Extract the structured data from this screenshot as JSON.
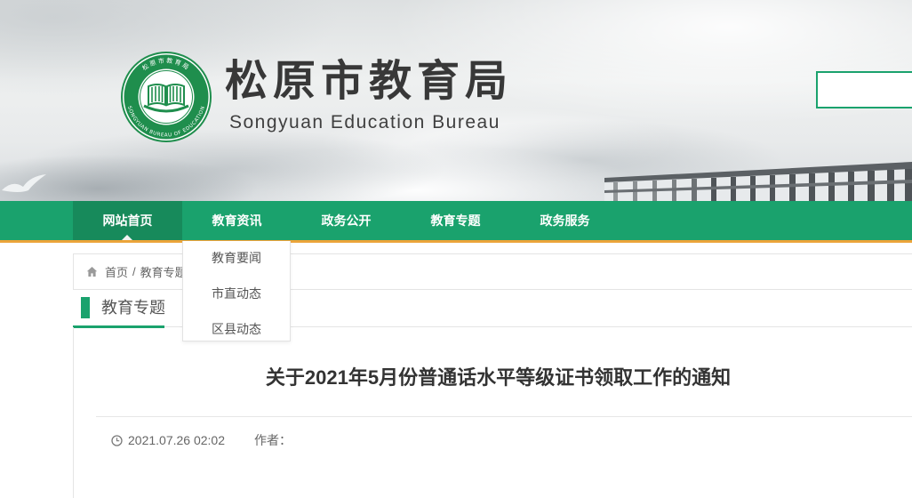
{
  "header": {
    "logo": {
      "icon": "book-emblem-icon",
      "ring_text_top": "松原市教育局",
      "ring_text_bottom": "SONGYUAN BUREAU OF EDUCATION"
    },
    "title": "松原市教育局",
    "subtitle": "Songyuan Education Bureau",
    "search": {
      "value": ""
    }
  },
  "nav": {
    "items": [
      {
        "label": "网站首页",
        "active": true
      },
      {
        "label": "教育资讯",
        "active": false
      },
      {
        "label": "政务公开",
        "active": false
      },
      {
        "label": "教育专题",
        "active": false
      },
      {
        "label": "政务服务",
        "active": false
      }
    ],
    "dropdown_items": [
      {
        "label": "教育要闻"
      },
      {
        "label": "市直动态"
      },
      {
        "label": "区县动态"
      }
    ]
  },
  "breadcrumb": {
    "icon": "home-icon",
    "home": "首页",
    "separator": "/",
    "current": "教育专题"
  },
  "section": {
    "title": "教育专题"
  },
  "article": {
    "title": "关于2021年5月份普通话水平等级证书领取工作的通知",
    "date_icon": "clock-icon",
    "date": "2021.07.26 02:02",
    "author_label": "作者："
  },
  "colors": {
    "brand_green": "#1aa26d",
    "nav_active": "#178a5b",
    "nav_underline": "#eba43a",
    "logo_green": "#1f8e4d"
  }
}
